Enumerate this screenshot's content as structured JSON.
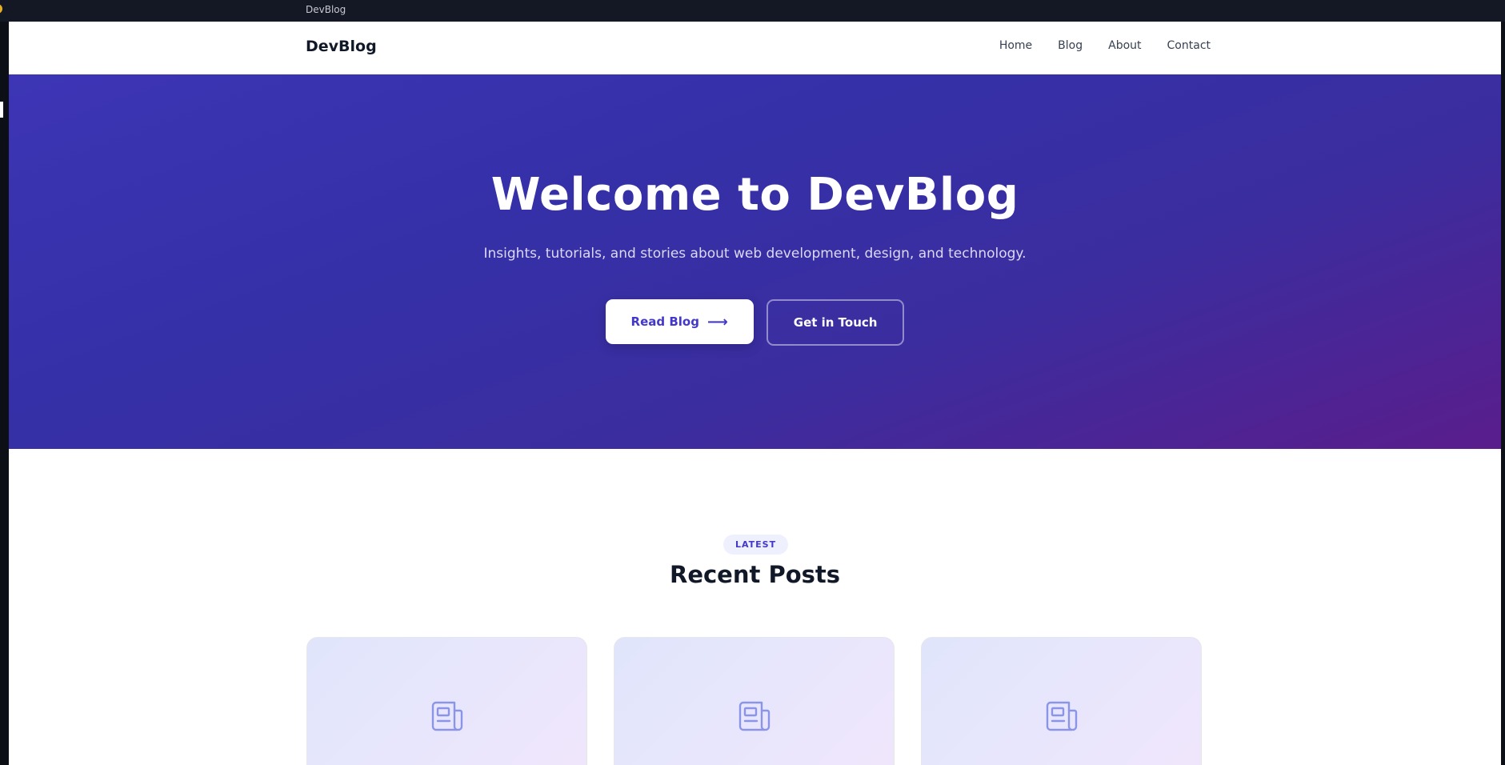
{
  "window": {
    "title": "DevBlog"
  },
  "nav": {
    "brand": "DevBlog",
    "links": [
      "Home",
      "Blog",
      "About",
      "Contact"
    ]
  },
  "hero": {
    "title": "Welcome to DevBlog",
    "subtitle": "Insights, tutorials, and stories about web development, design, and technology.",
    "primary_button": "Read Blog",
    "primary_button_icon": "arrow-right-icon",
    "secondary_button": "Get in Touch"
  },
  "posts": {
    "badge": "LATEST",
    "heading": "Recent Posts",
    "card_icon": "newspaper-icon"
  },
  "colors": {
    "accent": "#4338ca",
    "hero_start": "#3d35b5",
    "hero_end": "#5a1d8c"
  }
}
